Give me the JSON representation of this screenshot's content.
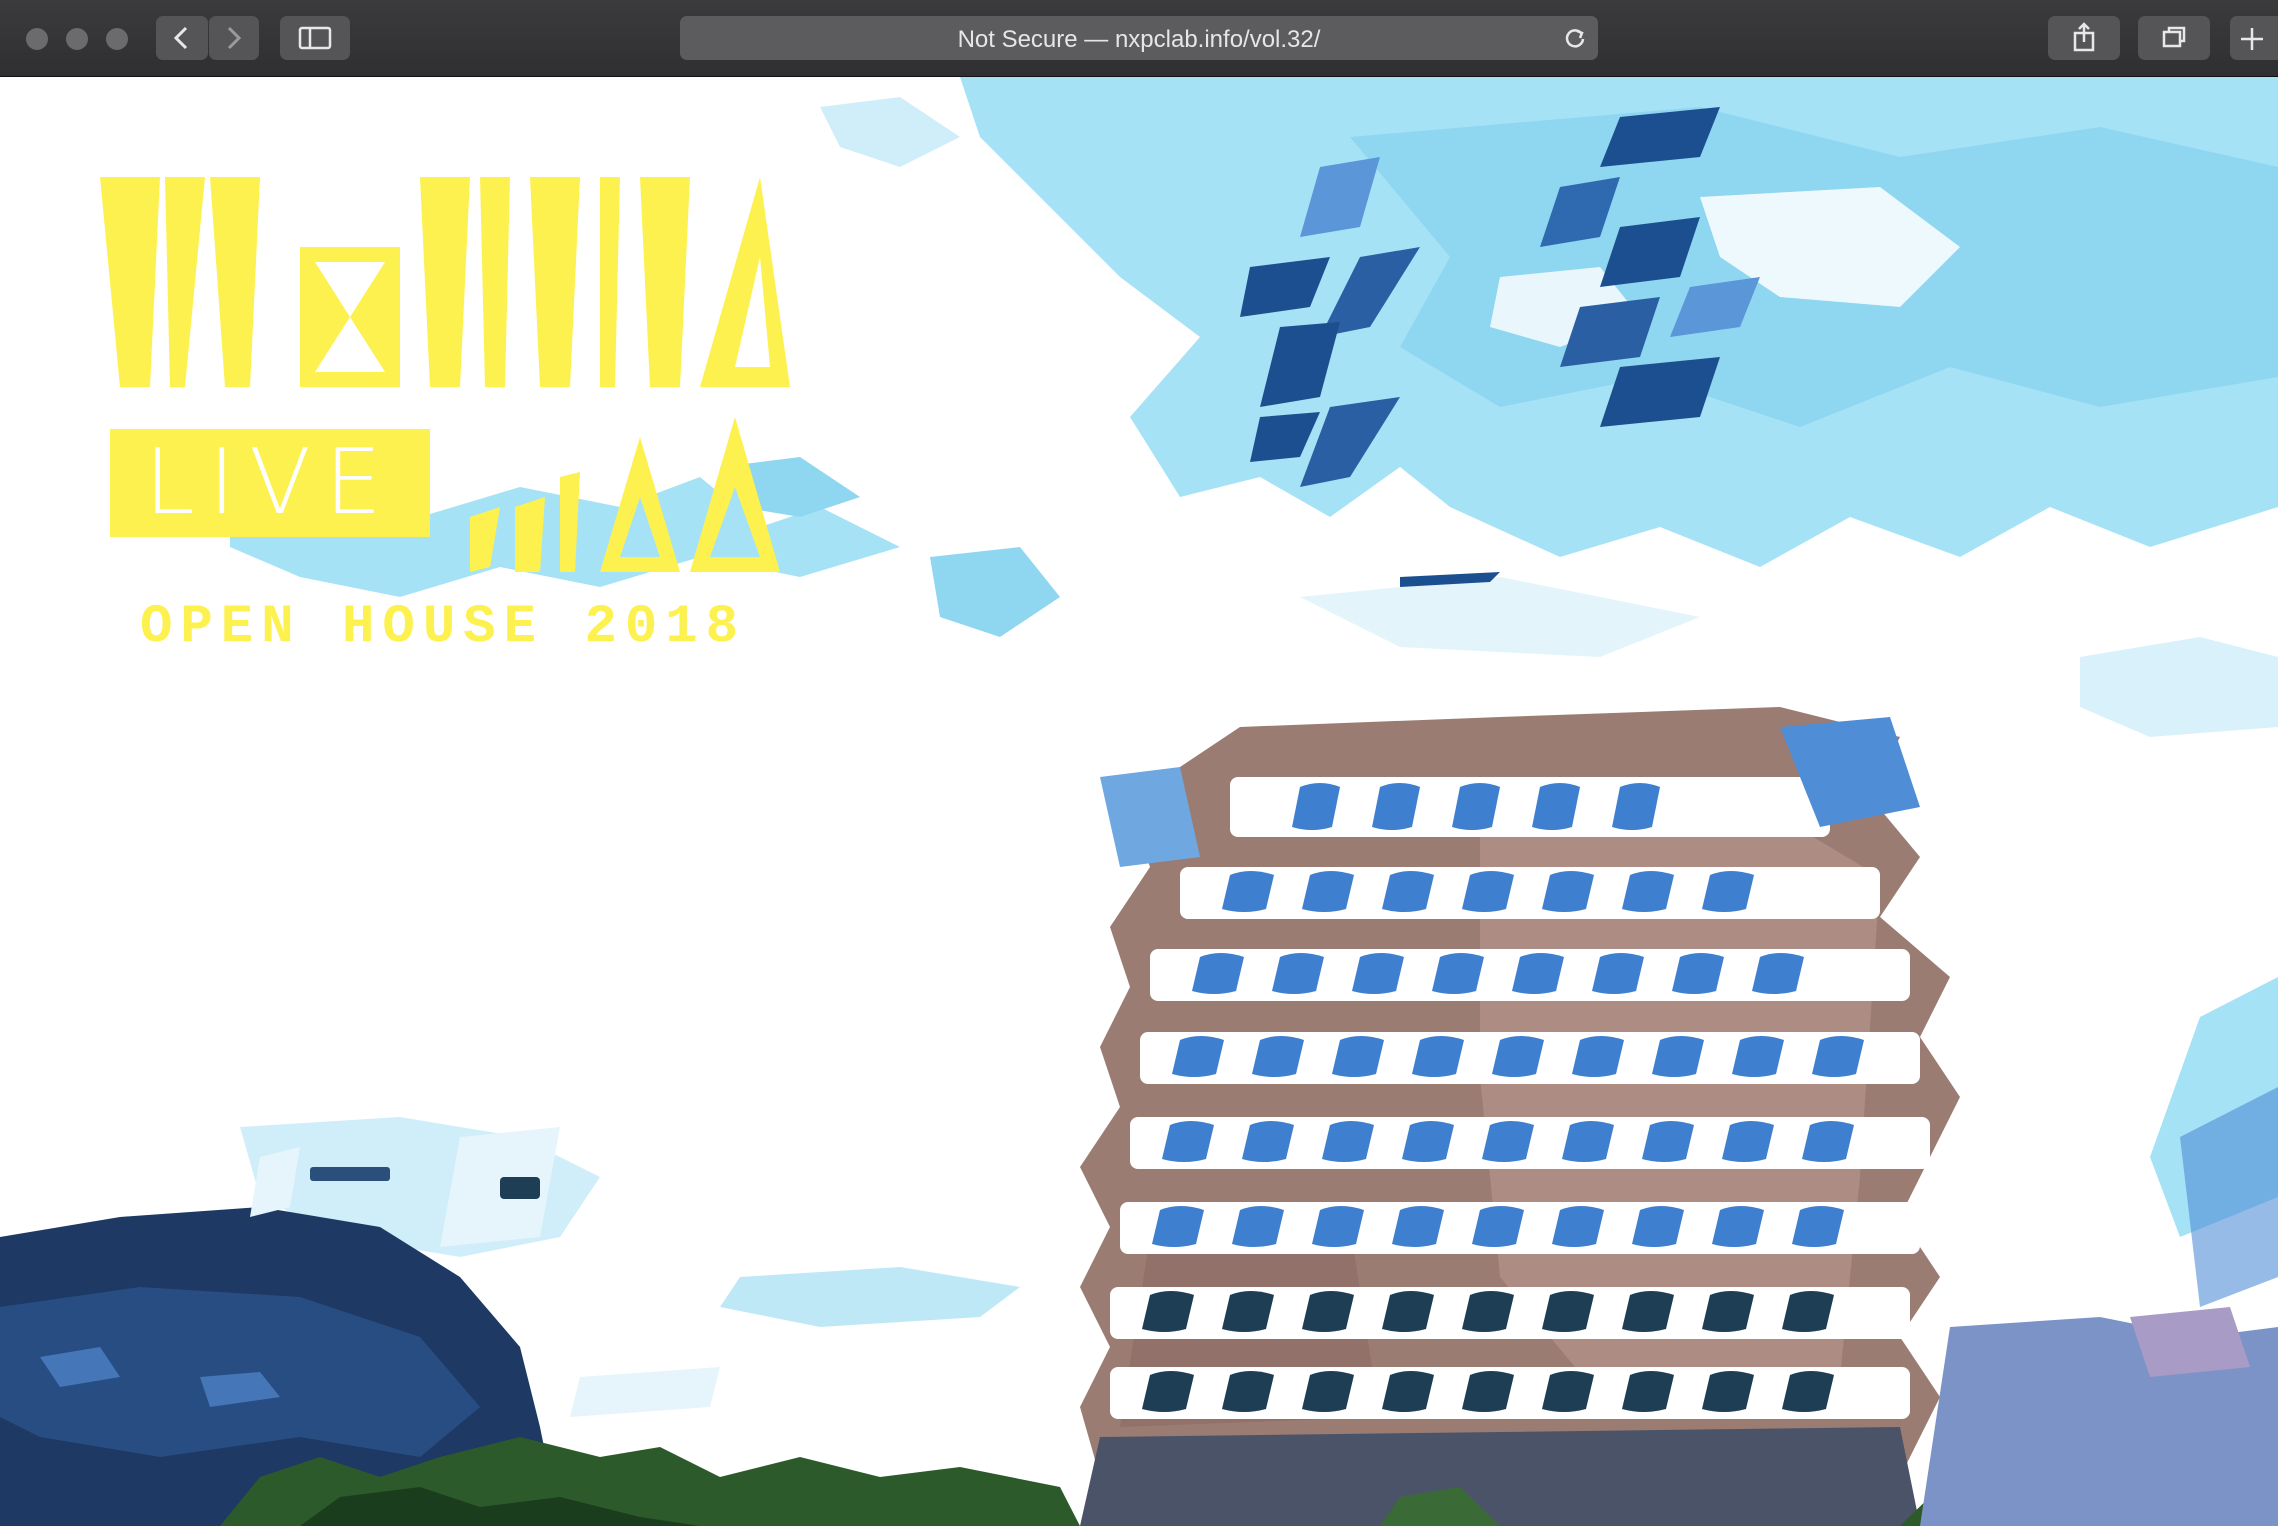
{
  "browser": {
    "address_text": "Not Secure — nxpclab.info/vol.32/"
  },
  "hero": {
    "live_label": "LIVE",
    "subtitle": "OPEN HOUSE 2018"
  },
  "icons": [
    "close-icon",
    "minimize-icon",
    "zoom-icon",
    "back-icon",
    "forward-icon",
    "sidebar-icon",
    "reload-icon",
    "share-icon",
    "tabs-icon",
    "new-tab-icon"
  ],
  "colors": {
    "accent_yellow": "#fdf14f",
    "sky_blue": "#9fdcf0",
    "window_blue": "#3f7fd0",
    "building_brown": "#9a7a70"
  }
}
